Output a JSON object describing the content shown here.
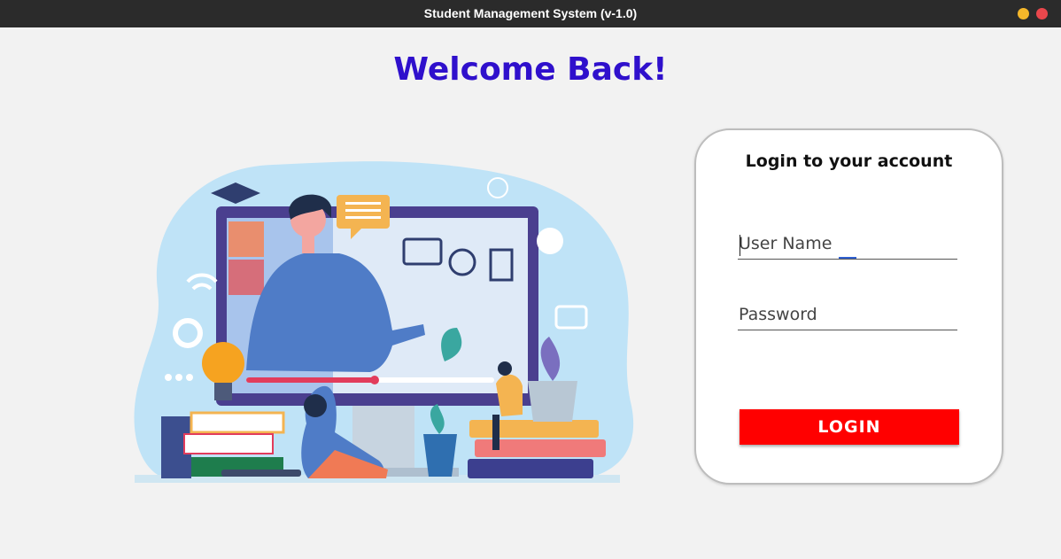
{
  "window": {
    "title": "Student Management System (v-1.0)",
    "minimize_color": "#f5b72a",
    "close_color": "#e9474c"
  },
  "header": {
    "welcome": "Welcome Back!",
    "color": "#2f10cc"
  },
  "illustration": {
    "description_icon": "online-learning-illustration"
  },
  "login": {
    "title": "Login to your account",
    "username_placeholder": "User Name",
    "username_value": "",
    "password_placeholder": "Password",
    "password_value": "",
    "button_label": "LOGIN",
    "button_color": "#ff0000"
  }
}
